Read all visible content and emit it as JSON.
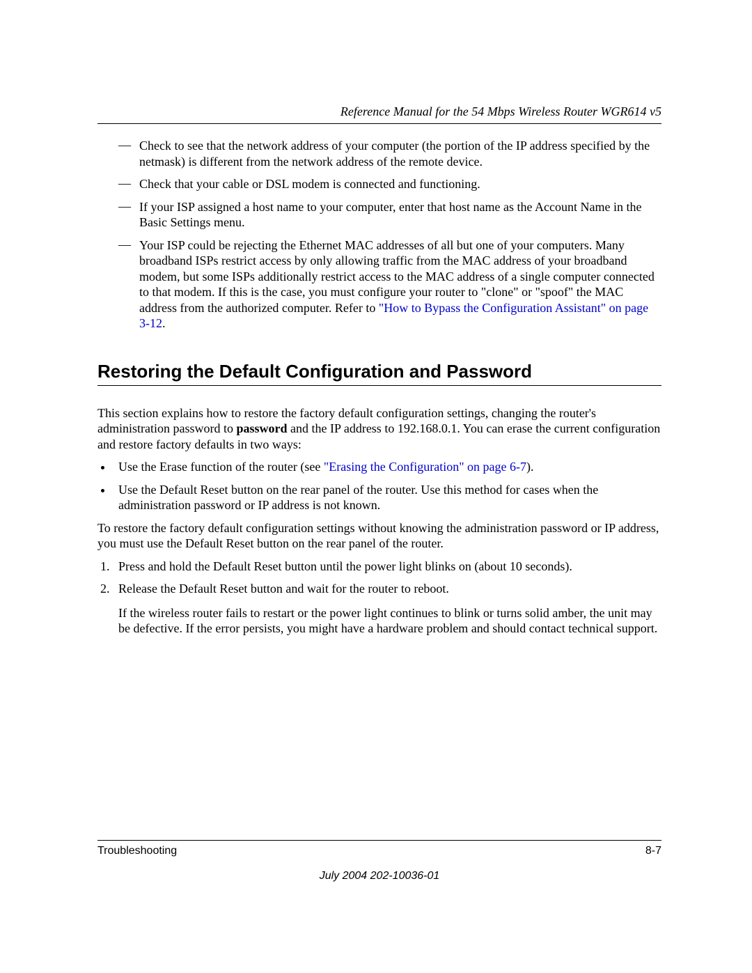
{
  "header": {
    "running_title": "Reference Manual for the 54 Mbps Wireless Router WGR614 v5"
  },
  "dash_items": [
    {
      "text": "Check to see that the network address of your computer (the portion of the IP address specified by the netmask) is different from the network address of the remote device."
    },
    {
      "text": "Check that your cable or DSL modem is connected and functioning."
    },
    {
      "text": "If your ISP assigned a host name to your computer, enter that host name as the Account Name in the Basic Settings menu."
    },
    {
      "text": "Your ISP could be rejecting the Ethernet MAC addresses of all but one of your computers. Many broadband ISPs restrict access by only allowing traffic from the MAC address of your broadband modem, but some ISPs additionally restrict access to the MAC address of a single computer connected to that modem. If this is the case, you must configure your router to \"clone\" or \"spoof\" the MAC address from the authorized computer. Refer to ",
      "link": "\"How to Bypass the Configuration Assistant\" on page 3-12",
      "after_link": "."
    }
  ],
  "section": {
    "heading": "Restoring the Default Configuration and Password",
    "intro_before_bold": "This section explains how to restore the factory default configuration settings, changing the router's administration password to ",
    "intro_bold": "password",
    "intro_after_bold": " and the IP address to 192.168.0.1. You can erase the current configuration and restore factory defaults in two ways:",
    "bullets": [
      {
        "before_link": "Use the Erase function of the router (see ",
        "link": "\"Erasing the Configuration\" on page 6-7",
        "after_link": ")."
      },
      {
        "text": "Use the Default Reset button on the rear panel of the router. Use this method for cases when the administration password or IP address is not known."
      }
    ],
    "para2": "To restore the factory default configuration settings without knowing the administration password or IP address, you must use the Default Reset button on the rear panel of the router.",
    "steps": [
      {
        "text": "Press and hold the Default Reset button until the power light blinks on (about 10 seconds)."
      },
      {
        "text": "Release the Default Reset button and wait for the router to reboot.",
        "para": "If the wireless router fails to restart or the power light continues to blink or turns solid amber, the unit may be defective. If the error persists, you might have a hardware problem and should contact technical support."
      }
    ]
  },
  "footer": {
    "section_name": "Troubleshooting",
    "page_number": "8-7",
    "pub_info": "July 2004 202-10036-01"
  }
}
